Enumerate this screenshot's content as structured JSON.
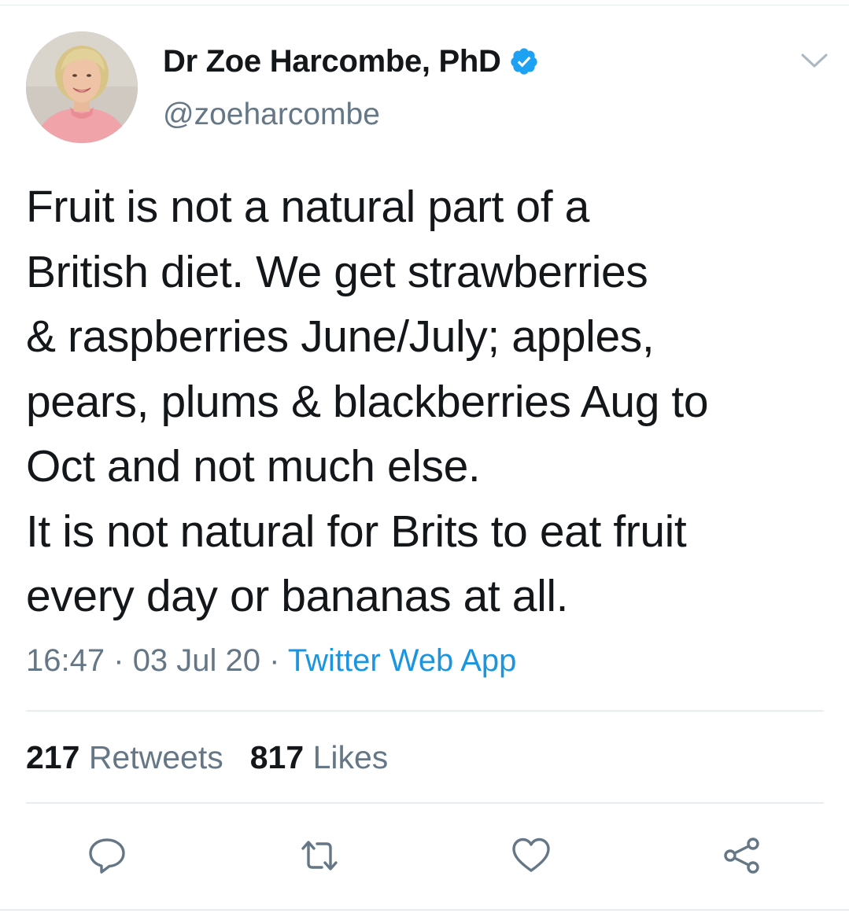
{
  "tweet": {
    "author": {
      "display_name": "Dr Zoe Harcombe, PhD",
      "handle": "@zoeharcombe",
      "verified": true
    },
    "text_lines": [
      "Fruit is not a natural part of a",
      "British diet. We get strawberries",
      "& raspberries June/July; apples,",
      "pears, plums & blackberries Aug to",
      "Oct and not much else.",
      "It is not natural for Brits to eat fruit",
      "every day or bananas at all."
    ],
    "time": "16:47",
    "date": "03 Jul 20",
    "separator": "·",
    "source": "Twitter Web App",
    "stats": {
      "retweets_count": "217",
      "retweets_label": "Retweets",
      "likes_count": "817",
      "likes_label": "Likes"
    }
  },
  "icons": {
    "verified": "verified-badge-icon",
    "menu": "chevron-down-icon",
    "reply": "reply-icon",
    "retweet": "retweet-icon",
    "like": "heart-icon",
    "share": "share-icon"
  },
  "colors": {
    "text": "#14171a",
    "secondary": "#657786",
    "link": "#1b95e0",
    "verified": "#1da1f2",
    "divider": "#e6ecf0"
  }
}
